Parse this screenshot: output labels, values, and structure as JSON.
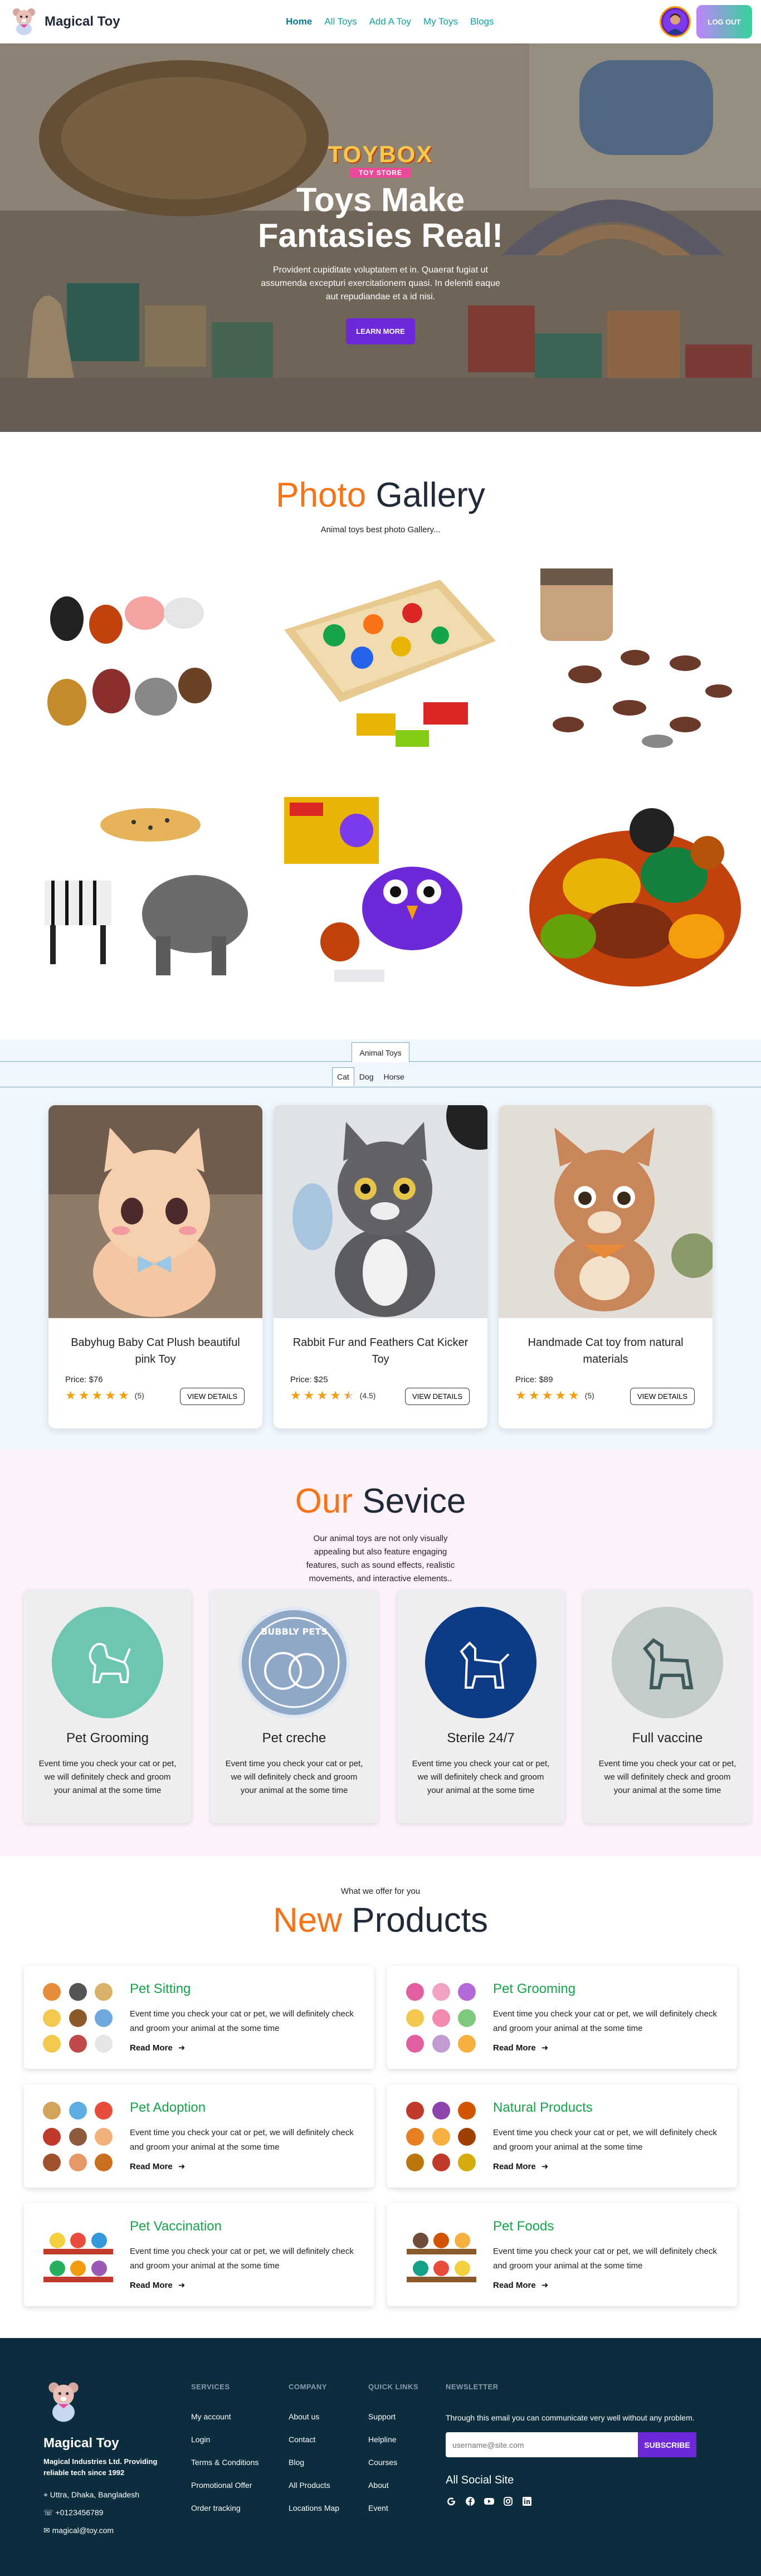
{
  "nav": {
    "brand": "Magical Toy",
    "links": [
      "Home",
      "All Toys",
      "Add A Toy",
      "My Toys",
      "Blogs"
    ],
    "logout": "LOG OUT"
  },
  "hero": {
    "logo_word": "TOYBOX",
    "logo_sub": "TOY STORE",
    "title_line1": "Toys Make",
    "title_line2": "Fantasies Real!",
    "text": "Provident cupiditate voluptatem et in. Quaerat fugiat ut assumenda excepturi exercitationem quasi. In deleniti eaque aut repudiandae et a id nisi.",
    "button": "LEARN MORE"
  },
  "gallery": {
    "title_hl": "Photo",
    "title_rest": "Gallery",
    "subtitle": "Animal toys best photo Gallery..."
  },
  "tabs": {
    "main": "Animal Toys",
    "sub": [
      "Cat",
      "Dog",
      "Horse"
    ],
    "cards": [
      {
        "title": "Babyhug Baby Cat Plush beautiful pink Toy",
        "price": "Price: $76",
        "rating": "(5)",
        "stars": 5,
        "button": "VIEW DETAILS"
      },
      {
        "title": "Rabbit Fur and Feathers Cat Kicker Toy",
        "price": "Price: $25",
        "rating": "(4.5)",
        "stars": 4.5,
        "button": "VIEW DETAILS"
      },
      {
        "title": "Handmade Cat toy from natural materials",
        "price": "Price: $89",
        "rating": "(5)",
        "stars": 5,
        "button": "VIEW DETAILS"
      }
    ]
  },
  "service": {
    "title_hl": "Our",
    "title_rest": "Sevice",
    "text": "Our animal toys are not only visually appealing but also feature engaging features, such as sound effects, realistic movements, and interactive elements..",
    "items": [
      {
        "name": "Pet Grooming",
        "desc": "Event time you check your cat or pet, we will definitely check and groom your animal at the some time",
        "color": "#6cc6b2"
      },
      {
        "name": "Pet creche",
        "desc": "Event time you check your cat or pet, we will definitely check and groom your animal at the some time",
        "color": "#8fa8c8",
        "badge": "BUBBLY PETS"
      },
      {
        "name": "Sterile 24/7",
        "desc": "Event time you check your cat or pet, we will definitely check and groom your animal at the some time",
        "color": "#0e3b85"
      },
      {
        "name": "Full vaccine",
        "desc": "Event time you check your cat or pet, we will definitely check and groom your animal at the some time",
        "color": "#c4cccb"
      }
    ]
  },
  "products": {
    "pretitle": "What we offer for you",
    "title_hl": "New",
    "title_rest": "Products",
    "items": [
      {
        "title": "Pet Sitting",
        "desc": "Event time you check your cat or pet, we will definitely check and groom your animal at the some time",
        "link": "Read More"
      },
      {
        "title": "Pet Grooming",
        "desc": "Event time you check your cat or pet, we will definitely check and groom your animal at the some time",
        "link": "Read More"
      },
      {
        "title": "Pet Adoption",
        "desc": "Event time you check your cat or pet, we will definitely check and groom your animal at the some time",
        "link": "Read More"
      },
      {
        "title": "Natural Products",
        "desc": "Event time you check your cat or pet, we will definitely check and groom your animal at the some time",
        "link": "Read More"
      },
      {
        "title": "Pet Vaccination",
        "desc": "Event time you check your cat or pet, we will definitely check and groom your animal at the some time",
        "link": "Read More"
      },
      {
        "title": "Pet Foods",
        "desc": "Event time you check your cat or pet, we will definitely check and groom your animal at the some time",
        "link": "Read More"
      }
    ]
  },
  "footer": {
    "name": "Magical Toy",
    "tagline": "Magical Industries Ltd. Providing reliable tech since 1992",
    "address": "Uttra, Dhaka, Bangladesh",
    "phone": "+0123456789",
    "email": "magical@toy.com",
    "columns": [
      {
        "heading": "SERVICES",
        "items": [
          "My account",
          "Login",
          "Terms & Conditions",
          "Promotional Offer",
          "Order tracking"
        ]
      },
      {
        "heading": "COMPANY",
        "items": [
          "About us",
          "Contact",
          "Blog",
          "All Products",
          "Locations Map"
        ]
      },
      {
        "heading": "QUICK LINKS",
        "items": [
          "Support",
          "Helpline",
          "Courses",
          "About",
          "Event"
        ]
      }
    ],
    "newsletter": {
      "heading": "NEWSLETTER",
      "text": "Through this email you can communicate very well without any problem.",
      "placeholder": "username@site.com",
      "button": "SUBSCRIBE",
      "social_title": "All Social Site"
    }
  }
}
